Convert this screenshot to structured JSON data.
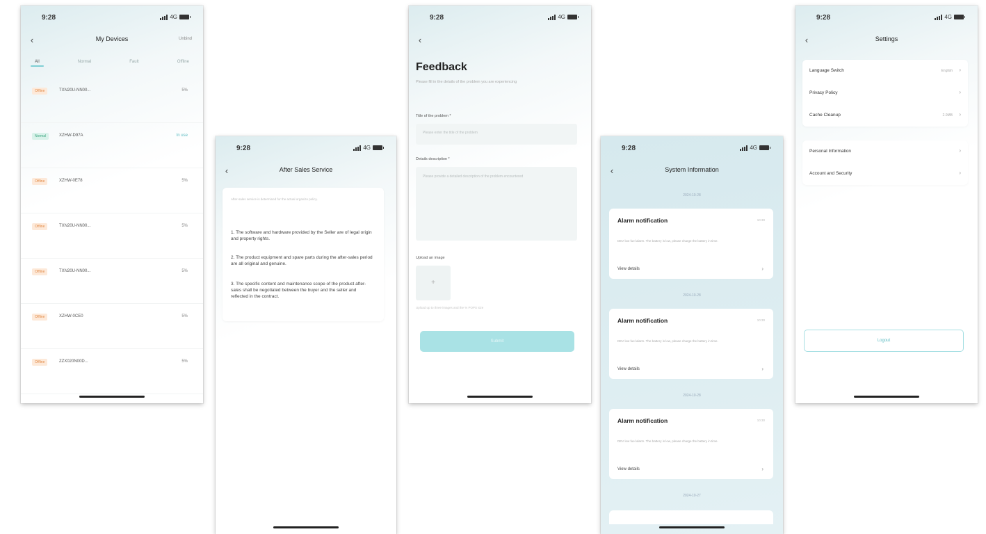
{
  "colors": {
    "accent": "#7fcfd4",
    "offline": "#e28a45",
    "normal": "#3aa57f",
    "submit": "#a9e2e5"
  },
  "icons": {
    "back": "chevron-left-icon",
    "row": "chevron-right-icon",
    "upload": "plus-icon"
  },
  "status_bar": {
    "time": "9:28",
    "network": "4G"
  },
  "screen1": {
    "title": "My Devices",
    "right_action": "Unbind",
    "tabs": [
      "All",
      "Normal",
      "Fault",
      "Offline"
    ],
    "devices": [
      {
        "status": "Offline",
        "name": "TXN20U-NN00...",
        "value": "5%"
      },
      {
        "status": "Normal",
        "name": "XZHW-D97A",
        "value": "In use"
      },
      {
        "status": "Offline",
        "name": "XZHW-0E78",
        "value": "5%"
      },
      {
        "status": "Offline",
        "name": "TXN20U-NN00...",
        "value": "5%"
      },
      {
        "status": "Offline",
        "name": "TXN20U-NN00...",
        "value": "5%"
      },
      {
        "status": "Offline",
        "name": "XZHW-0CE0",
        "value": "5%"
      },
      {
        "status": "Offline",
        "name": "ZZX020N00D...",
        "value": "5%"
      }
    ]
  },
  "screen2": {
    "title": "After Sales Service",
    "intro": "After-sales service is determined for the actual organize policy.",
    "paragraphs": [
      "1. The software and hardware provided by the Seller are of legal origin and property rights.",
      "2. The product equipment and spare parts during the after-sales period are all original and genuine.",
      "3. The specific content and maintenance scope of the product after-sales shall be negotiated between the buyer and the seller and reflected in the contract."
    ]
  },
  "screen3": {
    "title": "Feedback",
    "subtitle": "Please fill in the details of the problem you are experiencing",
    "problem_title_label": "Title of the problem *",
    "problem_title_placeholder": "Please enter the title of the problem",
    "description_label": "Details description *",
    "description_placeholder": "Please provide a detailed description of the problem encountered",
    "upload_label": "Upload an image",
    "upload_hint": "Upload up to three images and the % POPS size",
    "submit_label": "Submit"
  },
  "screen4": {
    "title": "System Information",
    "dates": [
      "2024-10-28",
      "2024-10-28",
      "2024-10-28",
      "2024-10-27"
    ],
    "notifications": [
      {
        "title": "Alarm notification",
        "time": "10:30",
        "message": "DEV low fuel alarm. The battery is low, please charge the battery in time.",
        "action": "View details"
      },
      {
        "title": "Alarm notification",
        "time": "10:30",
        "message": "DEV low fuel alarm. The battery is low, please charge the battery in time.",
        "action": "View details"
      },
      {
        "title": "Alarm notification",
        "time": "10:30",
        "message": "DEV low fuel alarm. The battery is low, please charge the battery in time.",
        "action": "View details"
      }
    ]
  },
  "screen5": {
    "title": "Settings",
    "group1": [
      {
        "label": "Language Switch",
        "value": "English"
      },
      {
        "label": "Privacy Policy",
        "value": ""
      },
      {
        "label": "Cache Cleanup",
        "value": "2.0MB"
      }
    ],
    "group2": [
      {
        "label": "Personal Information",
        "value": ""
      },
      {
        "label": "Account and Security",
        "value": ""
      }
    ],
    "logout_label": "Logout"
  }
}
